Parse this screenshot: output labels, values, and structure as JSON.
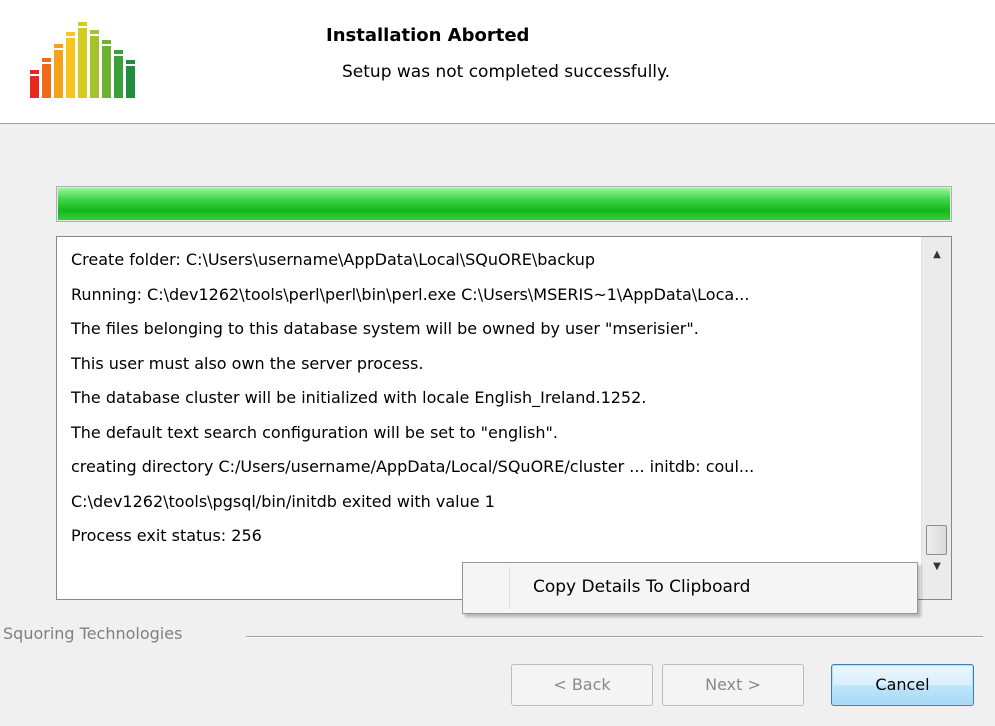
{
  "header": {
    "title": "Installation Aborted",
    "subtitle": "Setup was not completed successfully."
  },
  "progress": {
    "value": 1.0,
    "color": "#22c42a"
  },
  "log": {
    "lines": [
      "Create folder: C:\\Users\\username\\AppData\\Local\\SQuORE\\backup",
      "Running: C:\\dev1262\\tools\\perl\\perl\\bin\\perl.exe C:\\Users\\MSERIS~1\\AppData\\Loca...",
      "The files belonging to this database system will be owned by user \"mserisier\".",
      "This user must also own the server process.",
      "The database cluster will be initialized with locale English_Ireland.1252.",
      "The default text search configuration will be set to \"english\".",
      "creating directory C:/Users/username/AppData/Local/SQuORE/cluster ... initdb: coul...",
      "C:\\dev1262\\tools\\pgsql/bin/initdb exited with value 1",
      "Process exit status: 256"
    ]
  },
  "context_menu": {
    "copy_label": "Copy Details To Clipboard"
  },
  "footer": {
    "brand": "Squoring Technologies",
    "back_label": "< Back",
    "next_label": "Next >",
    "cancel_label": "Cancel"
  }
}
